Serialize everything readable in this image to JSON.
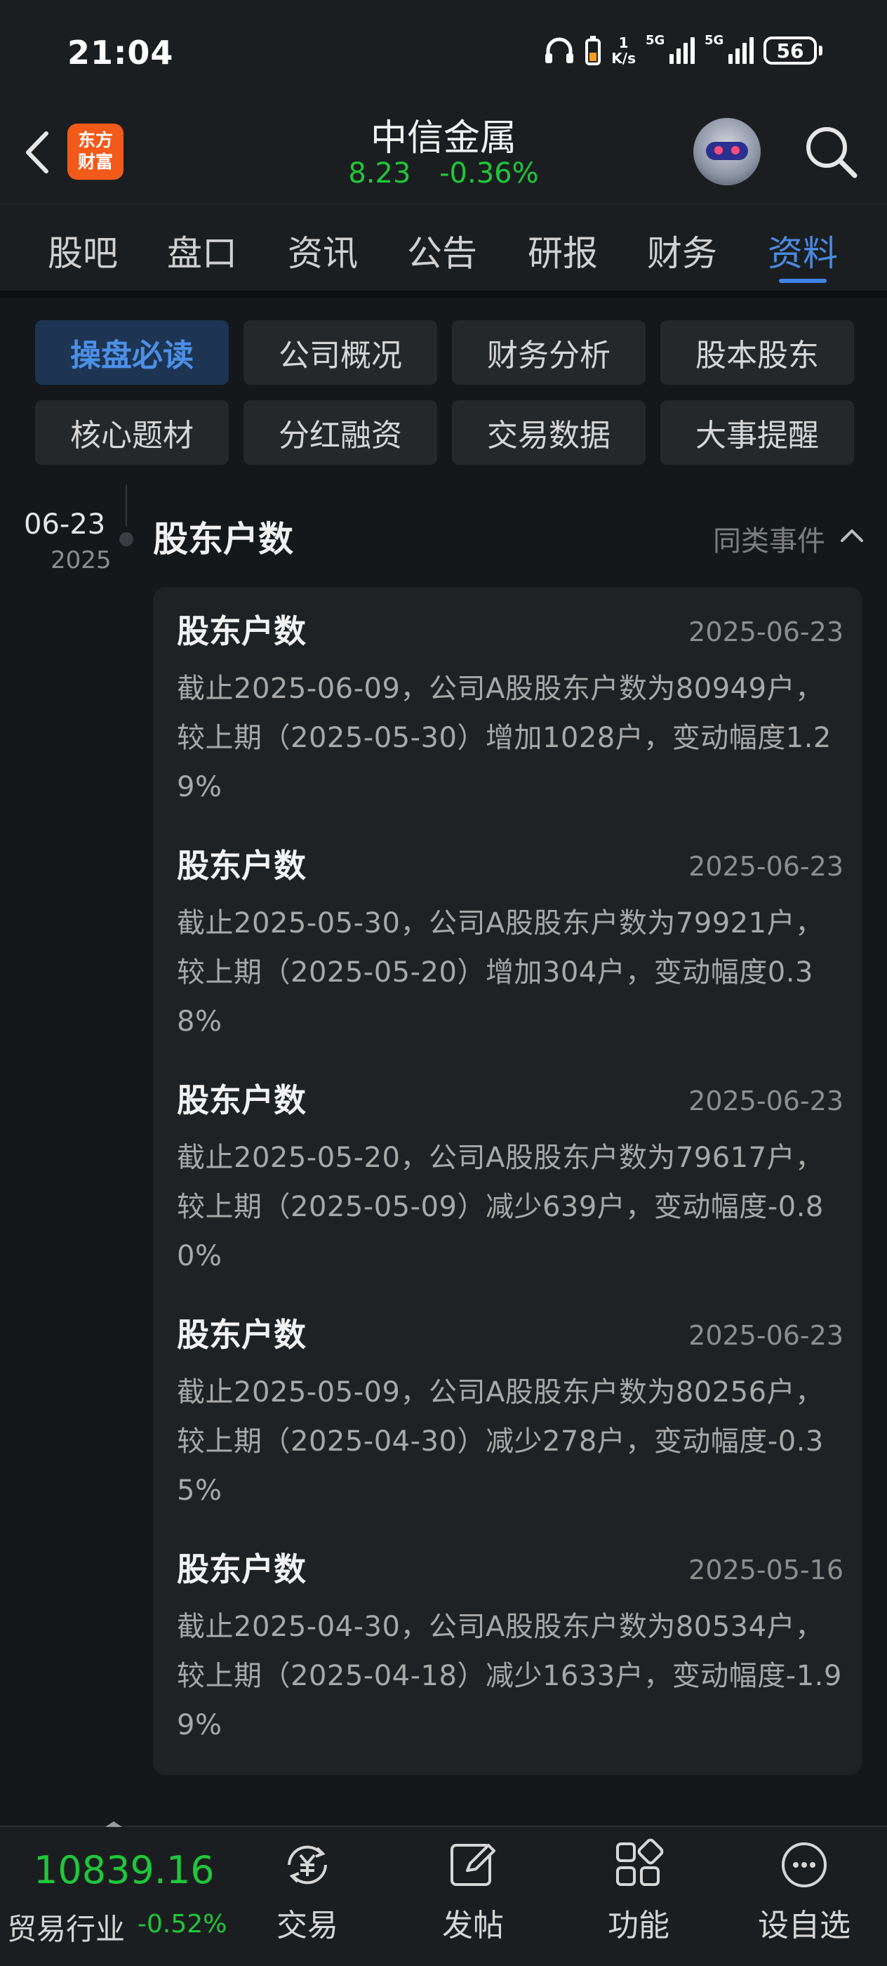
{
  "status_bar": {
    "time": "21:04",
    "net_speed_value": "1",
    "net_speed_unit": "K/s",
    "signal_1_label": "5G",
    "signal_2_label": "5G",
    "battery": "56"
  },
  "header": {
    "logo_line1": "东方",
    "logo_line2": "财富",
    "stock_name": "中信金属",
    "price": "8.23",
    "change_pct": "-0.36%"
  },
  "tabs": [
    {
      "label": "股吧"
    },
    {
      "label": "盘口"
    },
    {
      "label": "资讯"
    },
    {
      "label": "公告"
    },
    {
      "label": "研报"
    },
    {
      "label": "财务"
    },
    {
      "label": "资料",
      "active": true
    }
  ],
  "subnav": [
    {
      "label": "操盘必读",
      "active": true
    },
    {
      "label": "公司概况"
    },
    {
      "label": "财务分析"
    },
    {
      "label": "股本股东"
    },
    {
      "label": "核心题材"
    },
    {
      "label": "分红融资"
    },
    {
      "label": "交易数据"
    },
    {
      "label": "大事提醒"
    }
  ],
  "timeline": {
    "date": "06-23",
    "year": "2025",
    "section_title": "股东户数",
    "same_events_label": "同类事件"
  },
  "entries": [
    {
      "title": "股东户数",
      "date": "2025-06-23",
      "text": "截止2025-06-09，公司A股股东户数为80949户，较上期（2025-05-30）增加1028户，变动幅度1.29%"
    },
    {
      "title": "股东户数",
      "date": "2025-06-23",
      "text": "截止2025-05-30，公司A股股东户数为79921户，较上期（2025-05-20）增加304户，变动幅度0.38%"
    },
    {
      "title": "股东户数",
      "date": "2025-06-23",
      "text": "截止2025-05-20，公司A股股东户数为79617户，较上期（2025-05-09）减少639户，变动幅度-0.80%"
    },
    {
      "title": "股东户数",
      "date": "2025-06-23",
      "text": "截止2025-05-09，公司A股股东户数为80256户，较上期（2025-04-30）减少278户，变动幅度-0.35%"
    },
    {
      "title": "股东户数",
      "date": "2025-05-16",
      "text": "截止2025-04-30，公司A股股东户数为80534户，较上期（2025-04-18）减少1633户，变动幅度-1.99%"
    }
  ],
  "bottom_bar": {
    "index_value": "10839.16",
    "index_name": "贸易行业",
    "index_change": "-0.52%",
    "nav": [
      {
        "label": "交易",
        "icon": "yen-exchange-icon"
      },
      {
        "label": "发帖",
        "icon": "edit-post-icon"
      },
      {
        "label": "功能",
        "icon": "grid-apps-icon"
      },
      {
        "label": "设自选",
        "icon": "more-dots-icon"
      }
    ]
  },
  "colors": {
    "accent_blue": "#3f84e5",
    "down_green": "#1fc73a",
    "logo_orange": "#f25a1a",
    "background": "#15181a"
  }
}
